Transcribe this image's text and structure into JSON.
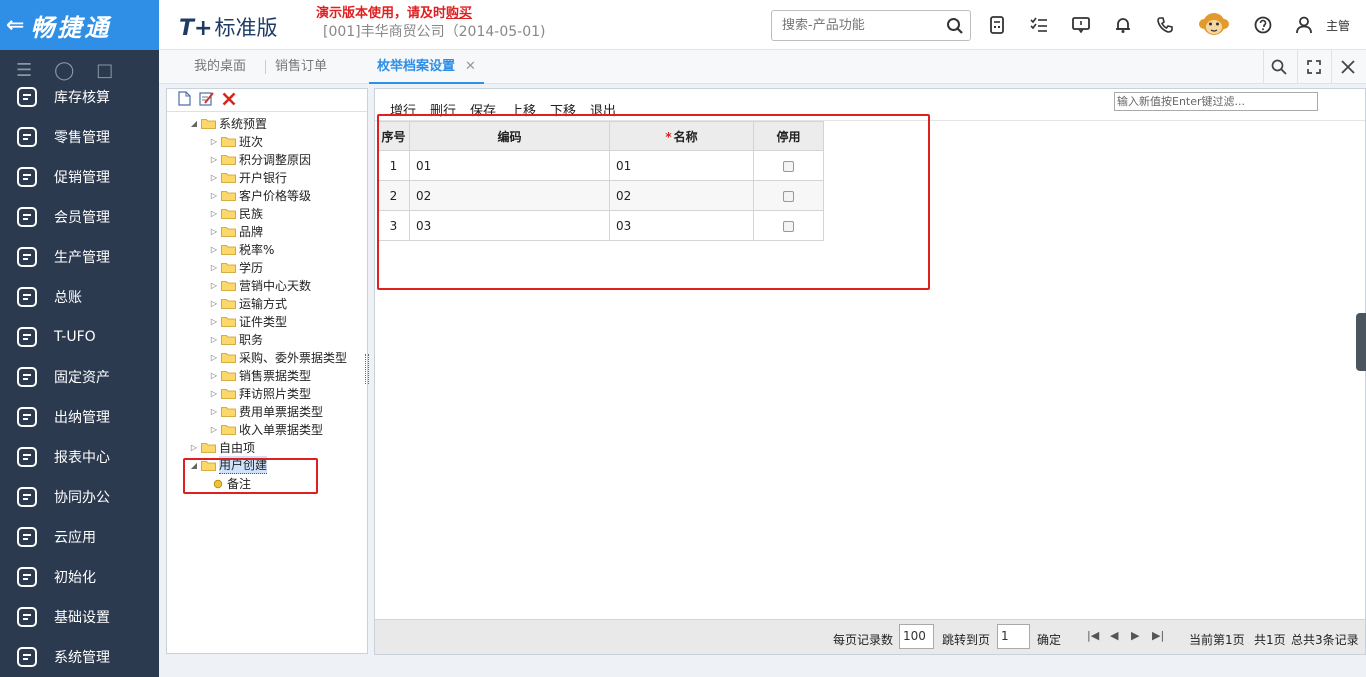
{
  "brand": {
    "name": "畅捷通"
  },
  "sidebar": {
    "items": [
      {
        "label": "库存核算",
        "icon": "inventory-icon"
      },
      {
        "label": "零售管理",
        "icon": "retail-icon"
      },
      {
        "label": "促销管理",
        "icon": "megaphone-icon"
      },
      {
        "label": "会员管理",
        "icon": "member-icon"
      },
      {
        "label": "生产管理",
        "icon": "production-icon"
      },
      {
        "label": "总账",
        "icon": "ledger-icon"
      },
      {
        "label": "T-UFO",
        "icon": "ufo-icon"
      },
      {
        "label": "固定资产",
        "icon": "bank-icon"
      },
      {
        "label": "出纳管理",
        "icon": "cashier-icon"
      },
      {
        "label": "报表中心",
        "icon": "pie-chart-icon"
      },
      {
        "label": "协同办公",
        "icon": "collaboration-icon"
      },
      {
        "label": "云应用",
        "icon": "cloud-icon"
      },
      {
        "label": "初始化",
        "icon": "refresh-icon"
      },
      {
        "label": "基础设置",
        "icon": "settings-icon"
      },
      {
        "label": "系统管理",
        "icon": "system-icon"
      }
    ]
  },
  "header": {
    "logo": "T+",
    "edition": "标准版",
    "demo_notice": "演示版本使用，请及时",
    "demo_link": "购买",
    "company": "[001]丰华商贸公司（2014-05-01)",
    "search_placeholder": "搜索-产品功能",
    "user": "主管"
  },
  "tabs": [
    {
      "label": "我的桌面",
      "active": false
    },
    {
      "label": "销售订单",
      "active": false
    },
    {
      "label": "枚举档案设置",
      "active": true
    }
  ],
  "tree": {
    "root": "系统预置",
    "children": [
      "班次",
      "积分调整原因",
      "开户银行",
      "客户价格等级",
      "民族",
      "品牌",
      "税率%",
      "学历",
      "营销中心天数",
      "运输方式",
      "证件类型",
      "职务",
      "采购、委外票据类型",
      "销售票据类型",
      "拜访照片类型",
      "费用单票据类型",
      "收入单票据类型"
    ],
    "free": "自由项",
    "user_node": "用户创建",
    "user_child": "备注"
  },
  "grid_toolbar": {
    "buttons": [
      "增行",
      "删行",
      "保存",
      "上移",
      "下移",
      "退出"
    ],
    "filter_placeholder": "输入新值按Enter键过滤..."
  },
  "grid": {
    "headers": [
      "序号",
      "编码",
      "名称",
      "停用"
    ],
    "rows": [
      {
        "seq": "1",
        "code": "01",
        "name": "01",
        "disabled": false
      },
      {
        "seq": "2",
        "code": "02",
        "name": "02",
        "disabled": false
      },
      {
        "seq": "3",
        "code": "03",
        "name": "03",
        "disabled": false
      }
    ]
  },
  "pager": {
    "per_page_label": "每页记录数",
    "per_page": "100",
    "jump_label": "跳转到页",
    "jump_page": "1",
    "confirm": "确定",
    "current": "当前第1页",
    "total_pages": "共1页",
    "total_records": "总共3条记录"
  },
  "colors": {
    "brand_blue": "#2f8fe6",
    "sidebar_bg": "#2b3a4f",
    "highlight_red": "#e02020"
  }
}
